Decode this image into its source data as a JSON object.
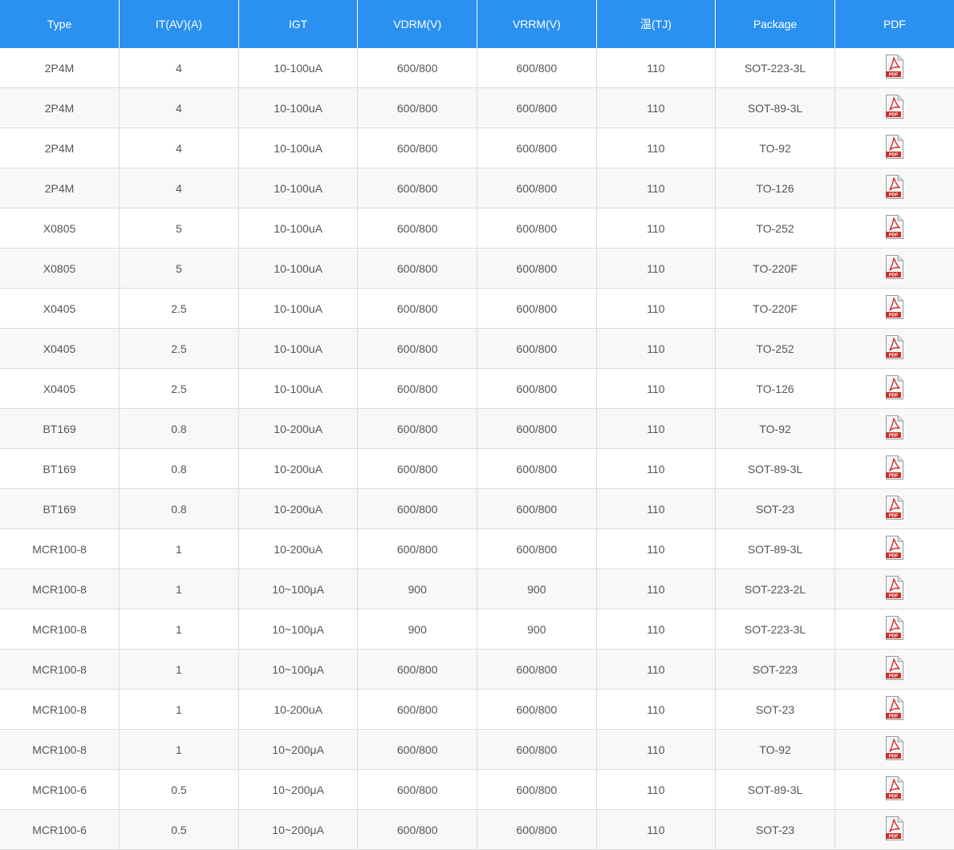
{
  "table": {
    "headers": [
      "Type",
      "IT(AV)(A)",
      "IGT",
      "VDRM(V)",
      "VRRM(V)",
      "温(TJ)",
      "Package",
      "PDF"
    ],
    "pdf_icon": "pdf-file-icon",
    "pdf_icon_label": "PDF",
    "colors": {
      "header_bg": "#2b91f0",
      "header_text": "#ffffff",
      "row_alt_bg": "#f8f8f8",
      "pdf_red": "#c9302c"
    },
    "rows": [
      [
        "2P4M",
        "4",
        "10-100uA",
        "600/800",
        "600/800",
        "110",
        "SOT-223-3L"
      ],
      [
        "2P4M",
        "4",
        "10-100uA",
        "600/800",
        "600/800",
        "110",
        "SOT-89-3L"
      ],
      [
        "2P4M",
        "4",
        "10-100uA",
        "600/800",
        "600/800",
        "110",
        "TO-92"
      ],
      [
        "2P4M",
        "4",
        "10-100uA",
        "600/800",
        "600/800",
        "110",
        "TO-126"
      ],
      [
        "X0805",
        "5",
        "10-100uA",
        "600/800",
        "600/800",
        "110",
        "TO-252"
      ],
      [
        "X0805",
        "5",
        "10-100uA",
        "600/800",
        "600/800",
        "110",
        "TO-220F"
      ],
      [
        "X0405",
        "2.5",
        "10-100uA",
        "600/800",
        "600/800",
        "110",
        "TO-220F"
      ],
      [
        "X0405",
        "2.5",
        "10-100uA",
        "600/800",
        "600/800",
        "110",
        "TO-252"
      ],
      [
        "X0405",
        "2.5",
        "10-100uA",
        "600/800",
        "600/800",
        "110",
        "TO-126"
      ],
      [
        "BT169",
        "0.8",
        "10-200uA",
        "600/800",
        "600/800",
        "110",
        "TO-92"
      ],
      [
        "BT169",
        "0.8",
        "10-200uA",
        "600/800",
        "600/800",
        "110",
        "SOT-89-3L"
      ],
      [
        "BT169",
        "0.8",
        "10-200uA",
        "600/800",
        "600/800",
        "110",
        "SOT-23"
      ],
      [
        "MCR100-8",
        "1",
        "10-200uA",
        "600/800",
        "600/800",
        "110",
        "SOT-89-3L"
      ],
      [
        "MCR100-8",
        "1",
        "10~100μA",
        "900",
        "900",
        "110",
        "SOT-223-2L"
      ],
      [
        "MCR100-8",
        "1",
        "10~100μA",
        "900",
        "900",
        "110",
        "SOT-223-3L"
      ],
      [
        "MCR100-8",
        "1",
        "10~100μA",
        "600/800",
        "600/800",
        "110",
        "SOT-223"
      ],
      [
        "MCR100-8",
        "1",
        "10-200uA",
        "600/800",
        "600/800",
        "110",
        "SOT-23"
      ],
      [
        "MCR100-8",
        "1",
        "10~200μA",
        "600/800",
        "600/800",
        "110",
        "TO-92"
      ],
      [
        "MCR100-6",
        "0.5",
        "10~200μA",
        "600/800",
        "600/800",
        "110",
        "SOT-89-3L"
      ],
      [
        "MCR100-6",
        "0.5",
        "10~200μA",
        "600/800",
        "600/800",
        "110",
        "SOT-23"
      ]
    ]
  }
}
